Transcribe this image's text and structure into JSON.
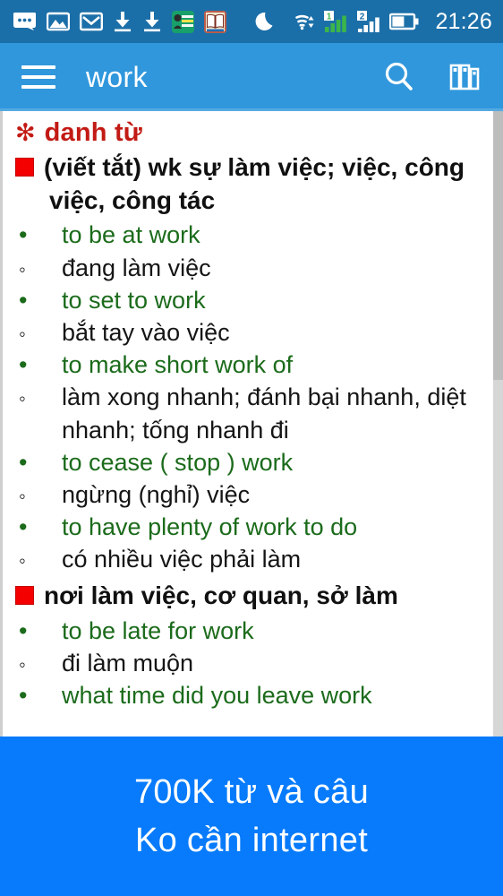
{
  "status_bar": {
    "background": "#1b6fa8",
    "time": "21:26",
    "icons": [
      {
        "name": "messages-icon",
        "label": "messages"
      },
      {
        "name": "gallery-icon",
        "label": "gallery"
      },
      {
        "name": "gmail-icon",
        "label": "gmail"
      },
      {
        "name": "download-icon-1",
        "label": "download"
      },
      {
        "name": "download-icon-2",
        "label": "download"
      },
      {
        "name": "bbc-learning-english-icon",
        "label": "BBC Learning English"
      },
      {
        "name": "dictionary-app-icon",
        "label": "dictionary"
      }
    ],
    "bbc_tile_text": "BBC Learning English",
    "right_icons": [
      {
        "name": "do-not-disturb-moon-icon",
        "label": "do not disturb"
      },
      {
        "name": "wifi-icon",
        "label": "wifi"
      },
      {
        "name": "signal-sim1-icon",
        "label": "1"
      },
      {
        "name": "signal-sim2-icon",
        "label": "2"
      },
      {
        "name": "battery-icon",
        "label": "battery"
      }
    ],
    "sim1_label": "1",
    "sim2_label": "2"
  },
  "app_bar": {
    "background": "#3097dc",
    "menu_icon": "hamburger-menu",
    "title": "work",
    "search_icon": "search",
    "books_icon": "bookshelf"
  },
  "entry": {
    "part_of_speech_marker": "✻",
    "part_of_speech": "danh từ",
    "senses": [
      {
        "definition": "(viết tắt) wk sự làm việc; việc, công việc, công tác",
        "examples": [
          {
            "en": "to be at work",
            "vi": "đang làm việc"
          },
          {
            "en": "to set to work",
            "vi": "bắt tay vào việc"
          },
          {
            "en": "to make short work of",
            "vi": "làm xong nhanh; đánh bại nhanh, diệt nhanh; tống nhanh đi"
          },
          {
            "en": "to cease ( stop ) work",
            "vi": "ngừng (nghỉ) việc"
          },
          {
            "en": "to have plenty of work to do",
            "vi": "có nhiều việc phải làm"
          }
        ]
      },
      {
        "definition": "nơi làm việc, cơ quan, sở làm",
        "examples": [
          {
            "en": "to be late for work",
            "vi": "đi làm muộn"
          },
          {
            "en": "what time did you leave work",
            "vi": ""
          }
        ]
      }
    ],
    "bullet_filled": "•",
    "bullet_hollow": "◦",
    "colors": {
      "pos_red": "#c21a14",
      "sense_square_red": "#f40000",
      "english_green": "#1b6b1b",
      "vietnamese_black": "#151515"
    }
  },
  "banner": {
    "background": "#077bfb",
    "line1": "700K từ và câu",
    "line2": "Ko cần internet"
  }
}
